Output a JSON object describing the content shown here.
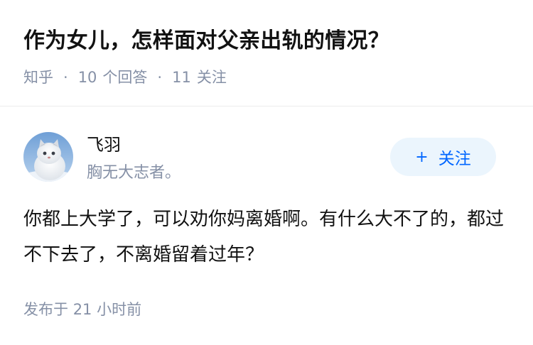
{
  "question": {
    "title": "作为女儿，怎样面对父亲出轨的情况？",
    "source": "知乎",
    "answer_count": "10",
    "answer_label": "个回答",
    "follow_count": "11",
    "follow_label": "关注"
  },
  "answer": {
    "author_name": "飞羽",
    "author_bio": "胸无大志者。",
    "follow_button_plus": "+",
    "follow_button_label": "关注",
    "content": "你都上大学了，可以劝你妈离婚啊。有什么大不了的，都过不下去了，不离婚留着过年？",
    "posted_prefix": "发布于",
    "posted_time": "21 小时前"
  },
  "colors": {
    "meta_gray": "#8590a6",
    "accent_blue": "#0066ff",
    "button_bg": "#ebf5fd"
  }
}
